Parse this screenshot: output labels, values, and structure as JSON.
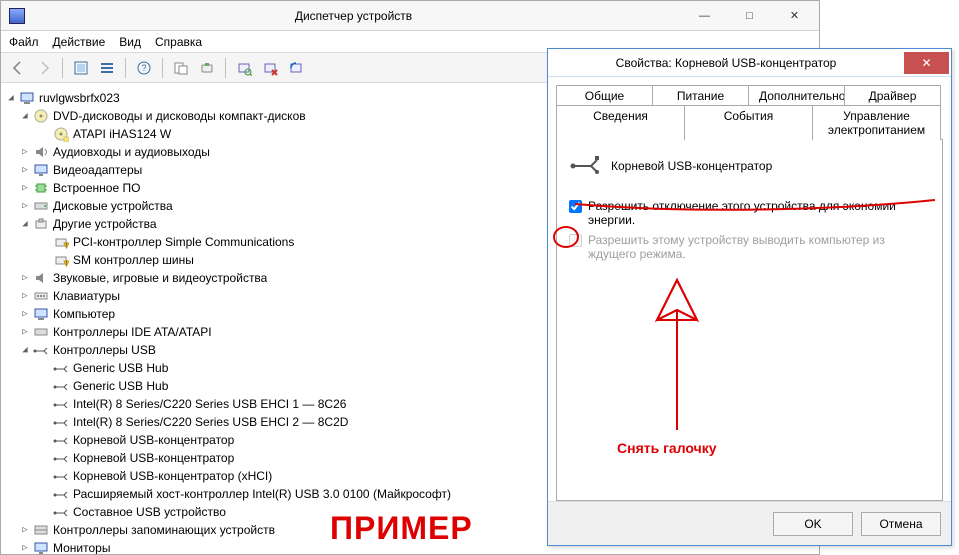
{
  "dm": {
    "title": "Диспетчер устройств",
    "menu": {
      "file": "Файл",
      "action": "Действие",
      "view": "Вид",
      "help": "Справка"
    },
    "cap": {
      "min": "—",
      "max": "□",
      "close": "✕"
    },
    "root": "ruvlgwsbrfx023",
    "tree": {
      "dvd": "DVD-дисководы и дисководы компакт-дисков",
      "dvd0": "ATAPI iHAS124   W",
      "audio": "Аудиовходы и аудиовыходы",
      "video": "Видеоадаптеры",
      "firmware": "Встроенное ПО",
      "disk": "Дисковые устройства",
      "other": "Другие устройства",
      "other0": "PCI-контроллер Simple Communications",
      "other1": "SM контроллер шины",
      "sound": "Звуковые, игровые и видеоустройства",
      "keyboard": "Клавиатуры",
      "computer": "Компьютер",
      "ide": "Контроллеры IDE ATA/ATAPI",
      "usb": "Контроллеры USB",
      "usb0": "Generic USB Hub",
      "usb1": "Generic USB Hub",
      "usb2": "Intel(R) 8 Series/C220 Series USB EHCI 1 — 8C26",
      "usb3": "Intel(R) 8 Series/C220 Series USB EHCI 2 — 8C2D",
      "usb4": "Корневой USB-концентратор",
      "usb5": "Корневой USB-концентратор",
      "usb6": "Корневой USB-концентратор (xHCI)",
      "usb7": "Расширяемый хост-контроллер Intel(R) USB 3.0 0100 (Майкрософт)",
      "usb8": "Составное USB устройство",
      "storage": "Контроллеры запоминающих устройств",
      "monitors": "Мониторы"
    }
  },
  "props": {
    "title": "Свойства: Корневой USB-концентратор",
    "close": "✕",
    "tabs": {
      "general": "Общие",
      "power": "Питание",
      "advanced": "Дополнительно",
      "driver": "Драйвер",
      "details": "Сведения",
      "events": "События",
      "powermgmt": "Управление электропитанием"
    },
    "device_name": "Корневой USB-концентратор",
    "chk1": "Разрешить отключение этого устройства для экономии энергии.",
    "chk2": "Разрешить этому устройству выводить компьютер из ждущего режима.",
    "ok": "OK",
    "cancel": "Отмена"
  },
  "ann": {
    "uncheck": "Снять галочку",
    "example": "ПРИМЕР"
  }
}
